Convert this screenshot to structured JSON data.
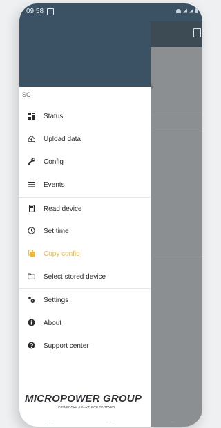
{
  "status_bar": {
    "time": "09:58"
  },
  "background_app": {
    "partial_text": "g"
  },
  "drawer": {
    "device_name": "SC",
    "items": [
      {
        "label": "Status",
        "icon": "status-grid-icon"
      },
      {
        "label": "Upload data",
        "icon": "cloud-upload-icon"
      },
      {
        "label": "Config",
        "icon": "wrench-icon"
      },
      {
        "label": "Events",
        "icon": "list-icon"
      },
      {
        "label": "Read device",
        "icon": "device-icon"
      },
      {
        "label": "Set time",
        "icon": "clock-icon"
      },
      {
        "label": "Copy config",
        "icon": "copy-icon",
        "active": true
      },
      {
        "label": "Select stored device",
        "icon": "folder-icon"
      },
      {
        "label": "Settings",
        "icon": "gears-icon"
      },
      {
        "label": "About",
        "icon": "info-icon"
      },
      {
        "label": "Support center",
        "icon": "help-icon"
      }
    ]
  },
  "logo": {
    "main": "MICROPOWER GROUP",
    "tagline": "POWERFUL SOLUTIONS PARTNER"
  },
  "colors": {
    "header": "#3a5264",
    "active": "#f2b930",
    "scrim": "#8c8f91"
  }
}
